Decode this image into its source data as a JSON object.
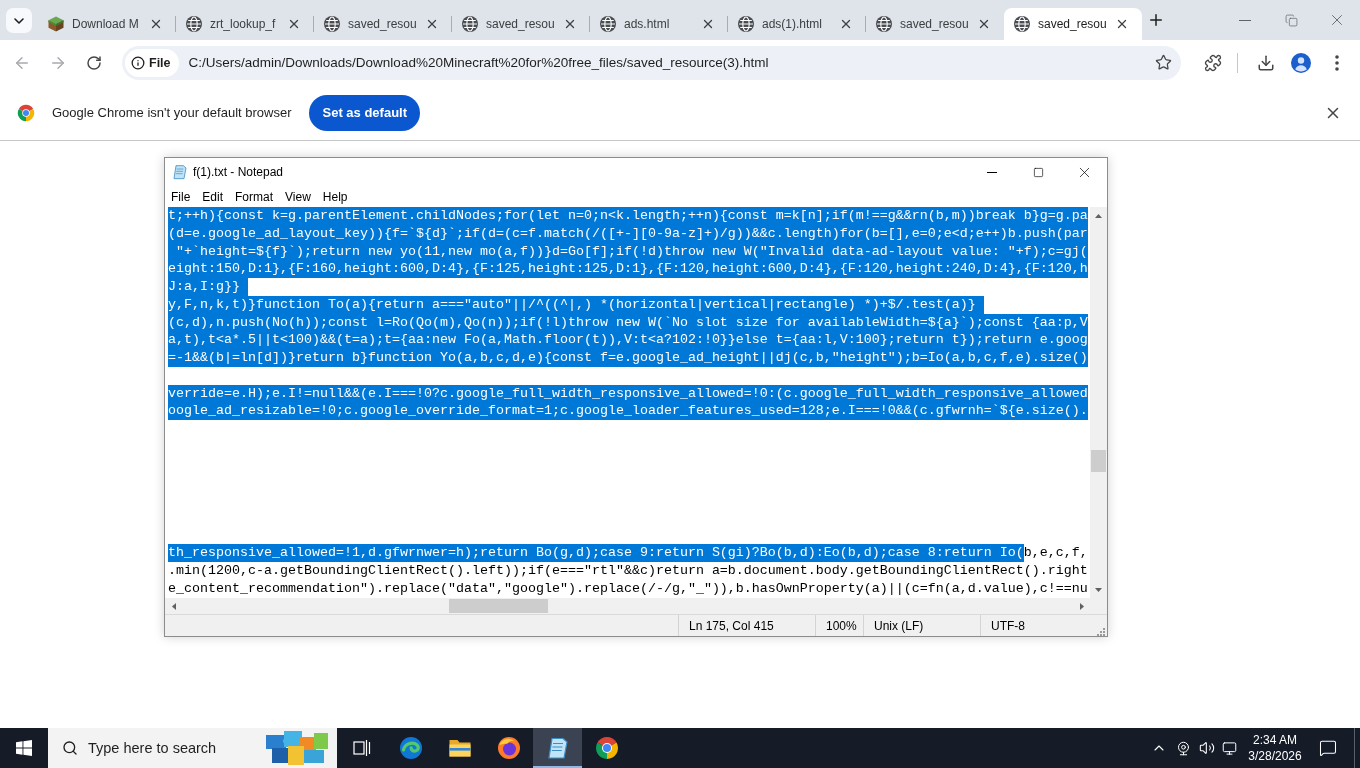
{
  "browser": {
    "tabs": [
      {
        "kind": "block",
        "title": "Download M",
        "selected": false
      },
      {
        "kind": "globe",
        "title": "zrt_lookup_f",
        "selected": false
      },
      {
        "kind": "globe",
        "title": "saved_resou",
        "selected": false
      },
      {
        "kind": "globe",
        "title": "saved_resou",
        "selected": false
      },
      {
        "kind": "globe",
        "title": "ads.html",
        "selected": false
      },
      {
        "kind": "globe",
        "title": "ads(1).html",
        "selected": false
      },
      {
        "kind": "globe",
        "title": "saved_resou",
        "selected": false
      },
      {
        "kind": "globe",
        "title": "saved_resou",
        "selected": true
      }
    ],
    "toolbar": {
      "back": {
        "disabled": true
      },
      "forward": {
        "disabled": true
      },
      "site_info": "File",
      "url": "C:/Users/admin/Downloads/Download%20Minecraft%20for%20free_files/saved_resource(3).html"
    },
    "infobar": {
      "message": "Google Chrome isn't your default browser",
      "button": "Set as default"
    }
  },
  "notepad": {
    "title": "f(1).txt - Notepad",
    "menu": [
      "File",
      "Edit",
      "Format",
      "View",
      "Help"
    ],
    "lines": [
      {
        "kind": "text",
        "segments": [
          {
            "text": "t;++h){const k=g.parentElement.childNodes;for(let n=0;n<k.length;++n){const m=k[n];if(m!==g&&rn(b,m))break b}g=g.pa",
            "selected": true
          }
        ]
      },
      {
        "kind": "text",
        "segments": [
          {
            "text": "(d=e.google_ad_layout_key)){f=`${d}`;if(d=(c=f.match(/([+-][0-9a-z]+)/g))&&c.length)for(b=[],e=0;e<d;e++)b.push(par",
            "selected": true
          }
        ]
      },
      {
        "kind": "text",
        "segments": [
          {
            "text": " \"+`height=${f}`);return new yo(11,new mo(a,f))}d=Go[f];if(!d)throw new W(\"Invalid data-ad-layout value: \"+f);c=gj(",
            "selected": true
          }
        ]
      },
      {
        "kind": "text",
        "segments": [
          {
            "text": "eight:150,D:1},{F:160,height:600,D:4},{F:125,height:125,D:1},{F:120,height:600,D:4},{F:120,height:240,D:4},{F:120,h",
            "selected": true
          }
        ]
      },
      {
        "kind": "text",
        "segments": [
          {
            "text": "J:a,I:g}}",
            "selected": true
          }
        ]
      },
      {
        "kind": "text",
        "segments": [
          {
            "text": "y,F,n,k,t)}function To(a){return a===\"auto\"||/^((^|,) *(horizontal|vertical|rectangle) *)+$/.test(a)}",
            "selected": true
          }
        ]
      },
      {
        "kind": "text",
        "segments": [
          {
            "text": "(c,d),n.push(No(h));const l=Ro(Qo(m),Qo(n));if(!l)throw new W(`No slot size for availableWidth=${a}`);const {aa:p,V",
            "selected": true
          }
        ]
      },
      {
        "kind": "text",
        "segments": [
          {
            "text": "a,t),t<a*.5||t<100)&&(t=a);t={aa:new Fo(a,Math.floor(t)),V:t<a?102:!0}}else t={aa:l,V:100};return t});return e.goog",
            "selected": true
          }
        ]
      },
      {
        "kind": "text",
        "segments": [
          {
            "text": "=-1&&(b|=ln[d])}return b}function Yo(a,b,c,d,e){const f=e.google_ad_height||dj(c,b,\"height\");b=Io(a,b,c,f,e).size()",
            "selected": true
          }
        ]
      },
      {
        "kind": "blank"
      },
      {
        "kind": "text",
        "segments": [
          {
            "text": "verride=e.H);e.I!=null&&(e.I===!0?c.google_full_width_responsive_allowed=!0:(c.google_full_width_responsive_allowed",
            "selected": true
          }
        ]
      },
      {
        "kind": "text",
        "segments": [
          {
            "text": "oogle_ad_resizable=!0;c.google_override_format=1;c.google_loader_features_used=128;e.I===!0&&(c.gfwrnh=`${e.size().",
            "selected": true
          }
        ]
      },
      {
        "kind": "blank"
      },
      {
        "kind": "blank"
      },
      {
        "kind": "blank"
      },
      {
        "kind": "blank"
      },
      {
        "kind": "blank"
      },
      {
        "kind": "blank"
      },
      {
        "kind": "blank"
      },
      {
        "kind": "text",
        "segments": [
          {
            "text": "th_responsive_allowed=!1,d.gfwrnwer=h);return Bo(g,d);case 9:return S(gi)?Bo(b,d):Eo(b,d);case 8:return Io(",
            "selected": true
          },
          {
            "text": "b,e,c,f,",
            "selected": false
          }
        ]
      },
      {
        "kind": "text",
        "segments": [
          {
            "text": ".min(1200,c-a.getBoundingClientRect().left));if(e===\"rtl\"&&c)return a=b.document.body.getBoundingClientRect().right",
            "selected": false
          }
        ]
      },
      {
        "kind": "text",
        "segments": [
          {
            "text": "e_content_recommendation\").replace(\"data\",\"google\").replace(/-/g,\"_\")),b.hasOwnProperty(a)||(c=fn(a,d.value),c!==nu",
            "selected": false
          }
        ]
      }
    ],
    "status": [
      "Ln 175, Col 415",
      "100%",
      "Unix (LF)",
      "UTF-8"
    ]
  },
  "taskbar": {
    "search": {
      "placeholder": "Type here to search"
    },
    "apps": [
      {
        "kind": "edge",
        "active": false
      },
      {
        "kind": "explorer",
        "active": false
      },
      {
        "kind": "firefox",
        "active": false
      },
      {
        "kind": "notepad",
        "active": true
      },
      {
        "kind": "chrome",
        "active": false
      }
    ],
    "clock": {
      "time": "2:34 AM",
      "date": "3/28/2026"
    }
  }
}
